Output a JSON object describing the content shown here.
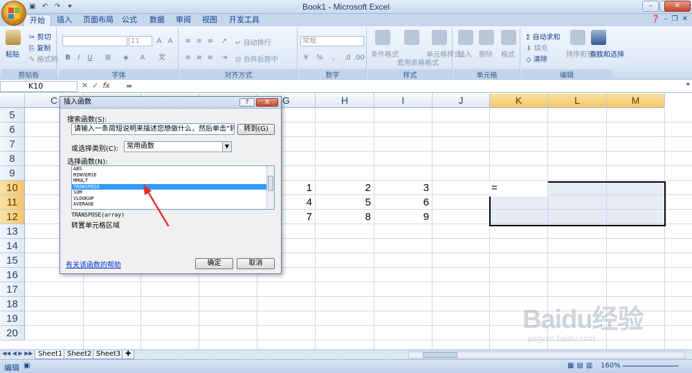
{
  "window": {
    "title": "Book1 - Microsoft Excel"
  },
  "tabs": [
    "开始",
    "插入",
    "页面布局",
    "公式",
    "数据",
    "审阅",
    "视图",
    "开发工具"
  ],
  "ribbon": {
    "clipboard": {
      "paste": "粘贴",
      "cut": "剪切",
      "copy": "复制",
      "format_painter": "格式刷",
      "label": "剪贴板"
    },
    "font": {
      "size": "11",
      "label": "字体"
    },
    "alignment": {
      "wrap": "自动换行",
      "merge": "合并后居中",
      "label": "对齐方式"
    },
    "number": {
      "format": "常规",
      "label": "数字"
    },
    "styles": {
      "conditional": "条件格式",
      "table": "套用表格格式",
      "cell": "单元格样式",
      "label": "样式"
    },
    "cells": {
      "insert": "插入",
      "delete": "删除",
      "format": "格式",
      "label": "单元格"
    },
    "editing": {
      "autosum": "自动求和",
      "fill": "填充",
      "clear": "清除",
      "sort": "排序和筛选",
      "find": "查找和选择",
      "label": "编辑"
    }
  },
  "formula_bar": {
    "name_box": "K10",
    "formula": "="
  },
  "grid": {
    "columns": [
      "C",
      "D",
      "E",
      "F",
      "G",
      "H",
      "I",
      "J",
      "K",
      "L",
      "M"
    ],
    "rows": [
      "5",
      "6",
      "7",
      "8",
      "9",
      "10",
      "11",
      "12",
      "13",
      "14",
      "15",
      "16",
      "17",
      "18",
      "19",
      "20"
    ],
    "values": [
      [
        "1",
        "2",
        "3"
      ],
      [
        "4",
        "5",
        "6"
      ],
      [
        "7",
        "8",
        "9"
      ]
    ],
    "active_cell_text": "="
  },
  "dialog": {
    "title": "插入函数",
    "search_label": "搜索函数(S):",
    "search_value": "请输入一条简短说明来描述您想做什么，然后单击“转到”",
    "go_button": "转到(G)",
    "category_label": "或选择类别(C):",
    "category_value": "常用函数",
    "select_label": "选择函数(N):",
    "functions": [
      "ABS",
      "MINVERSE",
      "MMULT",
      "TRANSPOSE",
      "SUM",
      "VLOOKUP",
      "AVERAGE"
    ],
    "selected_index": 3,
    "signature": "TRANSPOSE(array)",
    "description": "转置单元格区域",
    "help_link": "有关该函数的帮助",
    "ok": "确定",
    "cancel": "取消",
    "help_btn": "?",
    "close_btn": "X"
  },
  "sheets": [
    "Sheet1",
    "Sheet2",
    "Sheet3"
  ],
  "status": {
    "mode": "编辑",
    "zoom": "160%"
  },
  "watermark": {
    "main": "Baidu经验",
    "sub": "jingyan.baidu.com"
  },
  "colors": {
    "accent": "#15428b",
    "selection_header": "#f4c56a",
    "list_highlight": "#3399ff",
    "arrow": "#e0302a"
  }
}
